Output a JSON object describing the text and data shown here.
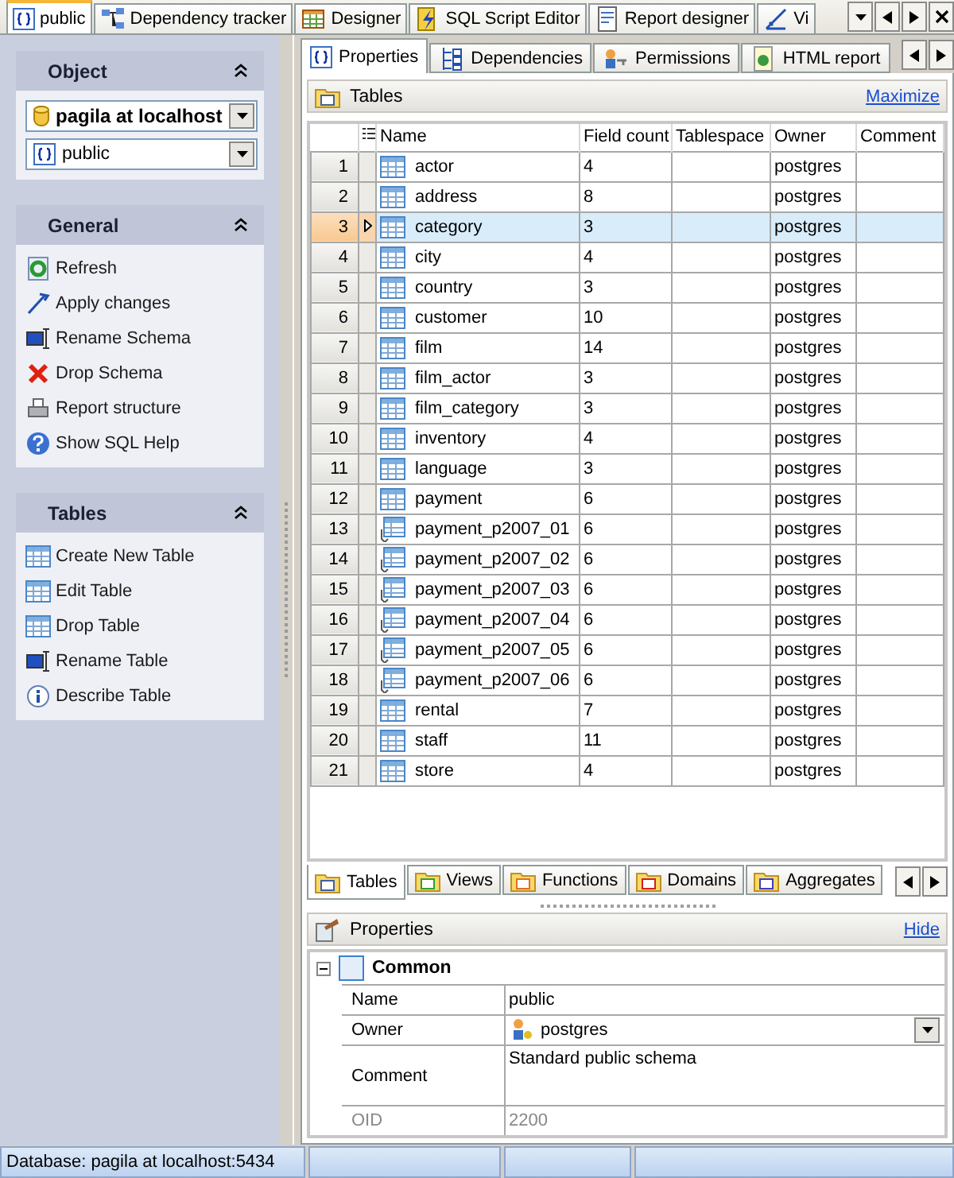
{
  "doc_tabs": [
    {
      "label": "public",
      "selected": true
    },
    {
      "label": "Dependency tracker",
      "selected": false
    },
    {
      "label": "Designer",
      "selected": false
    },
    {
      "label": "SQL Script Editor",
      "selected": false
    },
    {
      "label": "Report designer",
      "selected": false
    },
    {
      "label": "Vi",
      "selected": false
    }
  ],
  "sidebar": {
    "object": {
      "title": "Object",
      "database": "pagila at localhost",
      "schema": "public"
    },
    "general": {
      "title": "General",
      "items": [
        "Refresh",
        "Apply changes",
        "Rename Schema",
        "Drop Schema",
        "Report structure",
        "Show SQL Help"
      ]
    },
    "tables": {
      "title": "Tables",
      "items": [
        "Create New Table",
        "Edit Table",
        "Drop Table",
        "Rename Table",
        "Describe Table"
      ]
    }
  },
  "object_tabs": [
    {
      "label": "Properties",
      "selected": true
    },
    {
      "label": "Dependencies",
      "selected": false
    },
    {
      "label": "Permissions",
      "selected": false
    },
    {
      "label": "HTML report",
      "selected": false
    }
  ],
  "tables_section": {
    "title": "Tables",
    "action": "Maximize",
    "columns": [
      "Name",
      "Field count",
      "Tablespace",
      "Owner",
      "Comment"
    ],
    "rows": [
      {
        "number": "1",
        "kind": "table",
        "name": "actor",
        "field_count": "4",
        "owner": "postgres",
        "selected": false
      },
      {
        "number": "2",
        "kind": "table",
        "name": "address",
        "field_count": "8",
        "owner": "postgres",
        "selected": false
      },
      {
        "number": "3",
        "kind": "table",
        "name": "category",
        "field_count": "3",
        "owner": "postgres",
        "selected": true
      },
      {
        "number": "4",
        "kind": "table",
        "name": "city",
        "field_count": "4",
        "owner": "postgres",
        "selected": false
      },
      {
        "number": "5",
        "kind": "table",
        "name": "country",
        "field_count": "3",
        "owner": "postgres",
        "selected": false
      },
      {
        "number": "6",
        "kind": "table",
        "name": "customer",
        "field_count": "10",
        "owner": "postgres",
        "selected": false
      },
      {
        "number": "7",
        "kind": "table",
        "name": "film",
        "field_count": "14",
        "owner": "postgres",
        "selected": false
      },
      {
        "number": "8",
        "kind": "table",
        "name": "film_actor",
        "field_count": "3",
        "owner": "postgres",
        "selected": false
      },
      {
        "number": "9",
        "kind": "table",
        "name": "film_category",
        "field_count": "3",
        "owner": "postgres",
        "selected": false
      },
      {
        "number": "10",
        "kind": "table",
        "name": "inventory",
        "field_count": "4",
        "owner": "postgres",
        "selected": false
      },
      {
        "number": "11",
        "kind": "table",
        "name": "language",
        "field_count": "3",
        "owner": "postgres",
        "selected": false
      },
      {
        "number": "12",
        "kind": "table",
        "name": "payment",
        "field_count": "6",
        "owner": "postgres",
        "selected": false
      },
      {
        "number": "13",
        "kind": "partition",
        "name": "payment_p2007_01",
        "field_count": "6",
        "owner": "postgres",
        "selected": false
      },
      {
        "number": "14",
        "kind": "partition",
        "name": "payment_p2007_02",
        "field_count": "6",
        "owner": "postgres",
        "selected": false
      },
      {
        "number": "15",
        "kind": "partition",
        "name": "payment_p2007_03",
        "field_count": "6",
        "owner": "postgres",
        "selected": false
      },
      {
        "number": "16",
        "kind": "partition",
        "name": "payment_p2007_04",
        "field_count": "6",
        "owner": "postgres",
        "selected": false
      },
      {
        "number": "17",
        "kind": "partition",
        "name": "payment_p2007_05",
        "field_count": "6",
        "owner": "postgres",
        "selected": false
      },
      {
        "number": "18",
        "kind": "partition",
        "name": "payment_p2007_06",
        "field_count": "6",
        "owner": "postgres",
        "selected": false
      },
      {
        "number": "19",
        "kind": "table",
        "name": "rental",
        "field_count": "7",
        "owner": "postgres",
        "selected": false
      },
      {
        "number": "20",
        "kind": "table",
        "name": "staff",
        "field_count": "11",
        "owner": "postgres",
        "selected": false
      },
      {
        "number": "21",
        "kind": "table",
        "name": "store",
        "field_count": "4",
        "owner": "postgres",
        "selected": false
      }
    ]
  },
  "bottom_tabs": [
    {
      "label": "Tables",
      "selected": true
    },
    {
      "label": "Views",
      "selected": false
    },
    {
      "label": "Functions",
      "selected": false
    },
    {
      "label": "Domains",
      "selected": false
    },
    {
      "label": "Aggregates",
      "selected": false
    }
  ],
  "properties": {
    "title": "Properties",
    "action": "Hide",
    "group": "Common",
    "expanded": true,
    "rows": [
      {
        "kind": "text",
        "label": "Name",
        "value": "public"
      },
      {
        "kind": "dropdown",
        "label": "Owner",
        "value": "postgres"
      },
      {
        "kind": "memo",
        "label": "Comment",
        "value": "Standard public schema"
      },
      {
        "kind": "readonly",
        "label": "OID",
        "value": "2200"
      }
    ]
  },
  "status_bar": [
    "Database: pagila at localhost:5434"
  ]
}
